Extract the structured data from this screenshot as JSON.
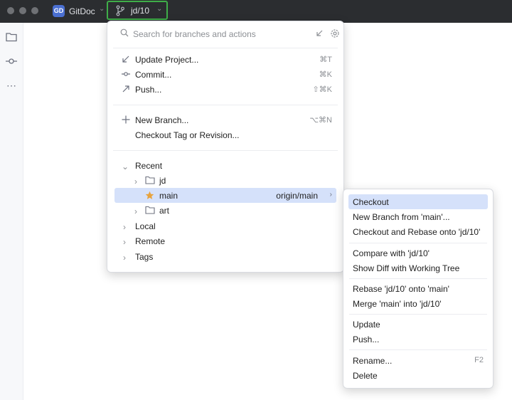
{
  "titlebar": {
    "project_badge": "GD",
    "project_name": "GitDoc",
    "branch": "jd/10"
  },
  "toolstrip": {
    "icons": [
      "folder-icon",
      "commit-icon",
      "more-icon"
    ],
    "more_label": "⋯"
  },
  "popup": {
    "search_placeholder": "Search for branches and actions",
    "actions": [
      {
        "icon": "update-project-icon",
        "label": "Update Project...",
        "shortcut": "⌘T"
      },
      {
        "icon": "commit-icon",
        "label": "Commit...",
        "shortcut": "⌘K"
      },
      {
        "icon": "push-icon",
        "label": "Push...",
        "shortcut": "⇧⌘K"
      }
    ],
    "branch_actions": [
      {
        "icon": "plus-icon",
        "label": "New Branch...",
        "shortcut": "⌥⌘N"
      },
      {
        "icon": "",
        "label": "Checkout Tag or Revision...",
        "shortcut": ""
      }
    ],
    "recent_label": "Recent",
    "recent": [
      {
        "label": "jd",
        "type": "folder",
        "expanded": false
      },
      {
        "label": "main",
        "type": "branch-favorite",
        "remote": "origin/main",
        "selected": true
      },
      {
        "label": "art",
        "type": "folder",
        "expanded": false
      }
    ],
    "groups": [
      "Local",
      "Remote",
      "Tags"
    ]
  },
  "submenu": {
    "sections": [
      [
        {
          "label": "Checkout",
          "selected": true
        },
        {
          "label": "New Branch from 'main'..."
        },
        {
          "label": "Checkout and Rebase onto 'jd/10'"
        }
      ],
      [
        {
          "label": "Compare with 'jd/10'"
        },
        {
          "label": "Show Diff with Working Tree"
        }
      ],
      [
        {
          "label": "Rebase 'jd/10' onto 'main'"
        },
        {
          "label": "Merge 'main' into 'jd/10'"
        }
      ],
      [
        {
          "label": "Update"
        },
        {
          "label": "Push..."
        }
      ],
      [
        {
          "label": "Rename...",
          "shortcut": "F2"
        },
        {
          "label": "Delete"
        }
      ]
    ]
  },
  "colors": {
    "titlebar": "#2b2d30",
    "selection": "#d5e1fa",
    "highlight_border": "#3fae49",
    "project_badge": "#4a6fd1",
    "favorite_star": "#e8a33d"
  }
}
